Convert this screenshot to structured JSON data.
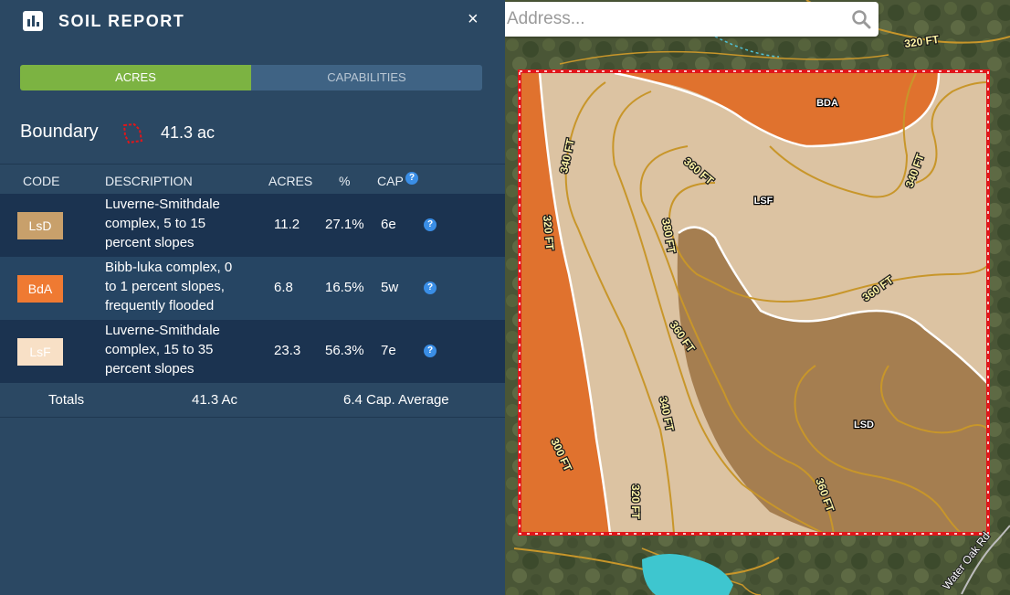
{
  "panel": {
    "title": "SOIL REPORT",
    "close_label": "×",
    "tabs": [
      {
        "label": "ACRES",
        "active": true
      },
      {
        "label": "CAPABILITIES",
        "active": false
      }
    ],
    "boundary_label": "Boundary",
    "boundary_value": "41.3 ac"
  },
  "table": {
    "headers": {
      "code": "CODE",
      "description": "DESCRIPTION",
      "acres": "ACRES",
      "percent": "%",
      "cap": "CAP"
    },
    "rows": [
      {
        "code": "LsD",
        "color": "#c8a06b",
        "text_color": "#ffffff",
        "description": "Luverne-Smithdale complex, 5 to 15 percent slopes",
        "acres": "11.2",
        "percent": "27.1%",
        "cap": "6e"
      },
      {
        "code": "BdA",
        "color": "#ef7a32",
        "text_color": "#ffffff",
        "description": "Bibb-luka complex, 0 to 1 percent slopes, frequently flooded",
        "acres": "6.8",
        "percent": "16.5%",
        "cap": "5w"
      },
      {
        "code": "LsF",
        "color": "#f8e0c6",
        "text_color": "#ffffff",
        "description": "Luverne-Smithdale complex, 15 to 35 percent slopes",
        "acres": "23.3",
        "percent": "56.3%",
        "cap": "7e"
      }
    ],
    "totals": {
      "label": "Totals",
      "acres": "41.3 Ac",
      "cap_average": "6.4 Cap. Average"
    }
  },
  "search": {
    "placeholder": "Address..."
  },
  "map": {
    "soil_labels": [
      "BDA",
      "LSF",
      "LSD"
    ],
    "contour_labels": [
      "320 FT",
      "340 FT",
      "360 FT",
      "380 FT",
      "300 FT"
    ],
    "road_label": "Water Oak Rd",
    "colors": {
      "boundary": "#e0161a",
      "lsf": "#dcc3a2",
      "lsd": "#a57e50",
      "bda": "#e0722e",
      "contour": "#c8962a",
      "water": "#3ec6cf"
    }
  }
}
